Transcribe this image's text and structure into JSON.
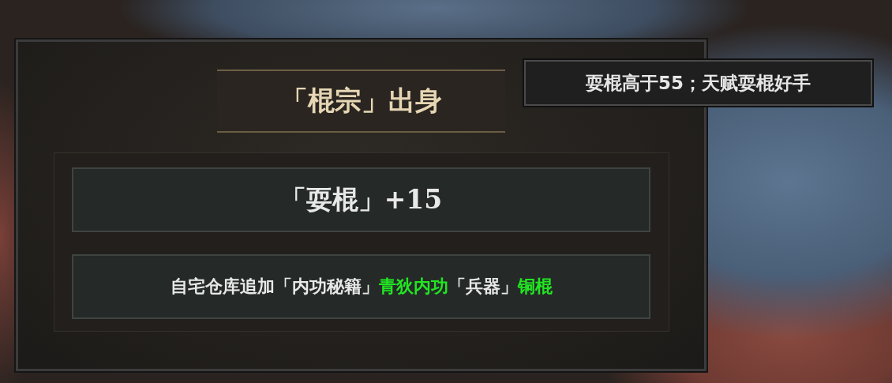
{
  "panel": {
    "title": "「棍宗」出身",
    "bonus": "「耍棍」+15",
    "reward": [
      {
        "text": "自宅仓库追加「内功秘籍」",
        "highlight": false
      },
      {
        "text": "青狄内功",
        "highlight": true
      },
      {
        "text": "「兵器」",
        "highlight": false
      },
      {
        "text": "铜棍",
        "highlight": true
      }
    ]
  },
  "tooltip": {
    "text": "耍棍高于55；天赋耍棍好手"
  }
}
